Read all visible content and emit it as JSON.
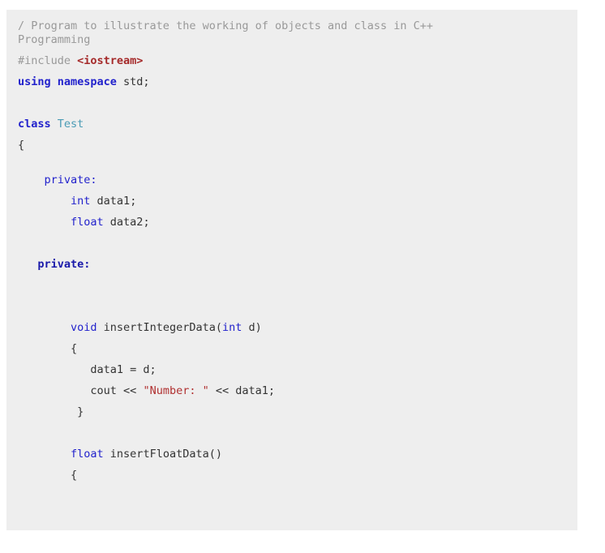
{
  "window": {
    "background_color": "#ffffff",
    "code_block_background": "#eeeeee"
  },
  "theme": {
    "comment_color": "#999999",
    "preprocessor_color": "#999999",
    "string_color": "#a52a2a",
    "keyword_color": "#2222cc",
    "type_color": "#2222cc",
    "class_name_color": "#4a9bb5",
    "plain_text_color": "#333333"
  },
  "code": {
    "language": "C++",
    "lines": [
      {
        "id": "l1",
        "spacing": "none",
        "tokens": [
          {
            "text": "/ Program to illustrate the working of objects and class in C++",
            "type": "comment"
          }
        ]
      },
      {
        "id": "l2",
        "spacing": "none",
        "tokens": [
          {
            "text": "Programming",
            "type": "comment"
          }
        ]
      },
      {
        "id": "l3",
        "spacing": "md",
        "tokens": [
          {
            "text": "#include ",
            "type": "pre"
          },
          {
            "text": "<iostream>",
            "type": "string"
          }
        ]
      },
      {
        "id": "l4",
        "spacing": "md",
        "tokens": [
          {
            "text": "using namespace",
            "type": "kw"
          },
          {
            "text": " std;",
            "type": "plain"
          }
        ]
      },
      {
        "id": "l5",
        "spacing": "md",
        "tokens": []
      },
      {
        "id": "l6",
        "spacing": "md",
        "tokens": [
          {
            "text": "class ",
            "type": "kw"
          },
          {
            "text": "Test",
            "type": "cls"
          }
        ]
      },
      {
        "id": "l7",
        "spacing": "md",
        "tokens": [
          {
            "text": "{",
            "type": "punct"
          }
        ]
      },
      {
        "id": "l8",
        "spacing": "md",
        "tokens": []
      },
      {
        "id": "l9",
        "spacing": "none",
        "tokens": [
          {
            "text": "    ",
            "type": "plain"
          },
          {
            "text": "private:",
            "type": "acc"
          }
        ]
      },
      {
        "id": "l10",
        "spacing": "md",
        "tokens": [
          {
            "text": "        ",
            "type": "plain"
          },
          {
            "text": "int",
            "type": "type"
          },
          {
            "text": " data1;",
            "type": "plain"
          }
        ]
      },
      {
        "id": "l11",
        "spacing": "md",
        "tokens": [
          {
            "text": "        ",
            "type": "plain"
          },
          {
            "text": "float",
            "type": "type"
          },
          {
            "text": " data2;",
            "type": "plain"
          }
        ]
      },
      {
        "id": "l12",
        "spacing": "md",
        "tokens": []
      },
      {
        "id": "l13",
        "spacing": "md",
        "tokens": [
          {
            "text": "   ",
            "type": "plain"
          },
          {
            "text": "private:",
            "type": "acc-b"
          }
        ]
      },
      {
        "id": "l14",
        "spacing": "md",
        "tokens": []
      },
      {
        "id": "l15",
        "spacing": "md",
        "tokens": []
      },
      {
        "id": "l16",
        "spacing": "md",
        "tokens": [
          {
            "text": "        ",
            "type": "plain"
          },
          {
            "text": "void",
            "type": "type"
          },
          {
            "text": " insertIntegerData(",
            "type": "plain"
          },
          {
            "text": "int",
            "type": "type"
          },
          {
            "text": " d)",
            "type": "plain"
          }
        ]
      },
      {
        "id": "l17",
        "spacing": "md",
        "tokens": [
          {
            "text": "        {",
            "type": "punct"
          }
        ]
      },
      {
        "id": "l18",
        "spacing": "md",
        "tokens": [
          {
            "text": "           data1 = d;",
            "type": "plain"
          }
        ]
      },
      {
        "id": "l19",
        "spacing": "md",
        "tokens": [
          {
            "text": "           cout << ",
            "type": "plain"
          },
          {
            "text": "\"Number: \"",
            "type": "str"
          },
          {
            "text": " << data1;",
            "type": "plain"
          }
        ]
      },
      {
        "id": "l20",
        "spacing": "md",
        "tokens": [
          {
            "text": "         }",
            "type": "punct"
          }
        ]
      },
      {
        "id": "l21",
        "spacing": "md",
        "tokens": []
      },
      {
        "id": "l22",
        "spacing": "md",
        "tokens": [
          {
            "text": "        ",
            "type": "plain"
          },
          {
            "text": "float",
            "type": "type"
          },
          {
            "text": " insertFloatData()",
            "type": "plain"
          }
        ]
      },
      {
        "id": "l23",
        "spacing": "md",
        "tokens": [
          {
            "text": "        {",
            "type": "punct"
          }
        ]
      }
    ]
  }
}
